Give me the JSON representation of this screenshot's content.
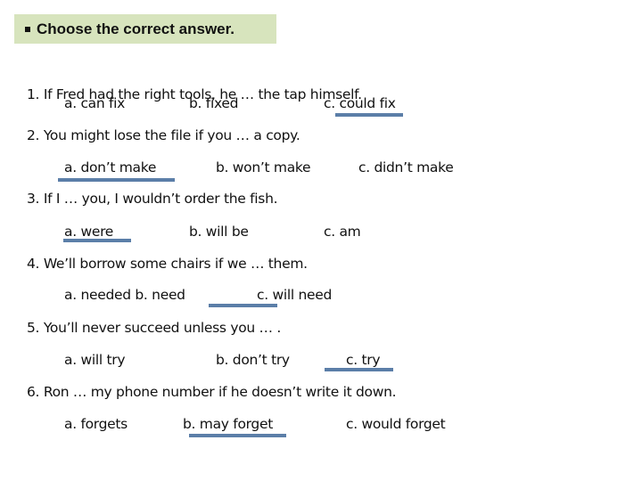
{
  "header": {
    "bullet_icon": "square-bullet",
    "title": "Choose the correct answer."
  },
  "accent_color": "#5b7ea8",
  "header_bg_color": "#d7e4bd",
  "questions": [
    {
      "text": "1. If Fred had the right tools, he … the tap himself.",
      "options": [
        "a. can fix",
        "b.   fixed",
        "c.   could fix"
      ],
      "correct_index": 2
    },
    {
      "text": "2. You might lose the file if you … a copy.",
      "options": [
        "a. don’t make",
        "b. won’t make",
        "c. didn’t make"
      ],
      "correct_index": 0
    },
    {
      "text": "3.  If I … you, I wouldn’t order the fish.",
      "options": [
        "a. were",
        "b.   will be",
        "c.   am"
      ],
      "correct_index": 0
    },
    {
      "text": "4.  We’ll borrow some chairs if we … them.",
      "options": [
        "a. needed b. need",
        "c.  will need"
      ],
      "correct_index": 1
    },
    {
      "text": "5.  You’ll never succeed unless you … .",
      "options": [
        "a.  will try",
        "b. don’t try",
        "c. try"
      ],
      "correct_index": 2
    },
    {
      "text": "6.  Ron … my phone number if he doesn’t write it down.",
      "options": [
        "a. forgets",
        "b.    may forget",
        "c. would forget"
      ],
      "correct_index": 1
    }
  ]
}
